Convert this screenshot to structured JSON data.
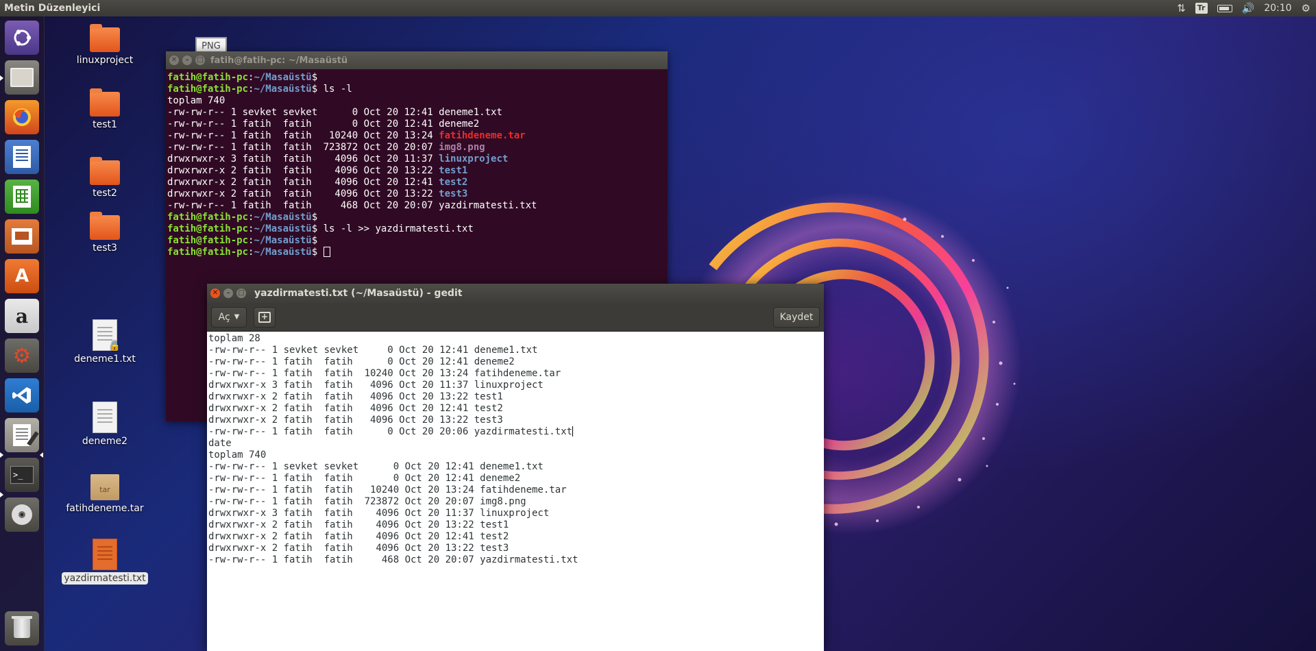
{
  "top_panel": {
    "app_title": "Metin Düzenleyici",
    "keyboard_layout": "Tr",
    "clock": "20:10",
    "icons": [
      "network-icon",
      "battery-icon",
      "volume-icon",
      "settings-gear-icon"
    ]
  },
  "launcher": {
    "items": [
      {
        "name": "ubuntu-dash",
        "icon": "ubuntu-logo-icon"
      },
      {
        "name": "files",
        "icon": "file-manager-icon"
      },
      {
        "name": "firefox",
        "icon": "firefox-icon"
      },
      {
        "name": "libreoffice-writer",
        "icon": "writer-icon"
      },
      {
        "name": "libreoffice-calc",
        "icon": "calc-icon"
      },
      {
        "name": "libreoffice-impress",
        "icon": "impress-icon"
      },
      {
        "name": "software-center",
        "icon": "software-center-icon"
      },
      {
        "name": "amazon",
        "icon": "amazon-icon"
      },
      {
        "name": "system-settings",
        "icon": "settings-tools-icon"
      },
      {
        "name": "vscode",
        "icon": "vscode-icon"
      },
      {
        "name": "text-editor",
        "icon": "text-editor-icon"
      },
      {
        "name": "terminal",
        "icon": "terminal-icon"
      },
      {
        "name": "dvd",
        "icon": "disc-icon"
      },
      {
        "name": "trash",
        "icon": "trash-icon"
      }
    ]
  },
  "desktop": {
    "icons": [
      {
        "label": "linuxproject",
        "type": "folder"
      },
      {
        "label": "test1",
        "type": "folder"
      },
      {
        "label": "test2",
        "type": "folder"
      },
      {
        "label": "test3",
        "type": "folder"
      },
      {
        "label": "deneme1.txt",
        "type": "locked-document"
      },
      {
        "label": "deneme2",
        "type": "document"
      },
      {
        "label": "fatihdeneme.tar",
        "type": "archive"
      },
      {
        "label": "yazdirmatesti.txt",
        "type": "text-document"
      }
    ],
    "png_thumb_label": "PNG"
  },
  "terminal": {
    "title": "fatih@fatih-pc: ~/Masaüstü",
    "prompt_user": "fatih@fatih-pc",
    "prompt_path": "~/Masaüstü",
    "prompt_sign": "$",
    "cmd_ls": " ls -l",
    "cmd_redirect": " ls -l >> yazdirmatesti.txt",
    "total": "toplam 740",
    "rows": [
      {
        "meta": "-rw-rw-r-- 1 sevket sevket      0 Oct 20 12:41 ",
        "name": "deneme1.txt",
        "kind": "file"
      },
      {
        "meta": "-rw-rw-r-- 1 fatih  fatih       0 Oct 20 12:41 ",
        "name": "deneme2",
        "kind": "file"
      },
      {
        "meta": "-rw-rw-r-- 1 fatih  fatih   10240 Oct 20 13:24 ",
        "name": "fatihdeneme.tar",
        "kind": "archive"
      },
      {
        "meta": "-rw-rw-r-- 1 fatih  fatih  723872 Oct 20 20:07 ",
        "name": "img8.png",
        "kind": "image"
      },
      {
        "meta": "drwxrwxr-x 3 fatih  fatih    4096 Oct 20 11:37 ",
        "name": "linuxproject",
        "kind": "dir"
      },
      {
        "meta": "drwxrwxr-x 2 fatih  fatih    4096 Oct 20 13:22 ",
        "name": "test1",
        "kind": "dir"
      },
      {
        "meta": "drwxrwxr-x 2 fatih  fatih    4096 Oct 20 12:41 ",
        "name": "test2",
        "kind": "dir"
      },
      {
        "meta": "drwxrwxr-x 2 fatih  fatih    4096 Oct 20 13:22 ",
        "name": "test3",
        "kind": "dir"
      },
      {
        "meta": "-rw-rw-r-- 1 fatih  fatih     468 Oct 20 20:07 ",
        "name": "yazdirmatesti.txt",
        "kind": "file"
      }
    ]
  },
  "gedit": {
    "title": "yazdirmatesti.txt (~/Masaüstü) - gedit",
    "open_button": "Aç",
    "save_button": "Kaydet",
    "lines": [
      "toplam 28",
      "-rw-rw-r-- 1 sevket sevket     0 Oct 20 12:41 deneme1.txt",
      "-rw-rw-r-- 1 fatih  fatih      0 Oct 20 12:41 deneme2",
      "-rw-rw-r-- 1 fatih  fatih  10240 Oct 20 13:24 fatihdeneme.tar",
      "drwxrwxr-x 3 fatih  fatih   4096 Oct 20 11:37 linuxproject",
      "drwxrwxr-x 2 fatih  fatih   4096 Oct 20 13:22 test1",
      "drwxrwxr-x 2 fatih  fatih   4096 Oct 20 12:41 test2",
      "drwxrwxr-x 2 fatih  fatih   4096 Oct 20 13:22 test3",
      "-rw-rw-r-- 1 fatih  fatih      0 Oct 20 20:06 yazdirmatesti.txt",
      "date",
      "toplam 740",
      "-rw-rw-r-- 1 sevket sevket      0 Oct 20 12:41 deneme1.txt",
      "-rw-rw-r-- 1 fatih  fatih       0 Oct 20 12:41 deneme2",
      "-rw-rw-r-- 1 fatih  fatih   10240 Oct 20 13:24 fatihdeneme.tar",
      "-rw-rw-r-- 1 fatih  fatih  723872 Oct 20 20:07 img8.png",
      "drwxrwxr-x 3 fatih  fatih    4096 Oct 20 11:37 linuxproject",
      "drwxrwxr-x 2 fatih  fatih    4096 Oct 20 13:22 test1",
      "drwxrwxr-x 2 fatih  fatih    4096 Oct 20 12:41 test2",
      "drwxrwxr-x 2 fatih  fatih    4096 Oct 20 13:22 test3",
      "-rw-rw-r-- 1 fatih  fatih     468 Oct 20 20:07 yazdirmatesti.txt"
    ]
  },
  "colors": {
    "terminal_bg": "#300a24",
    "prompt_user": "#8ae234",
    "prompt_path": "#729fcf",
    "dir": "#729fcf",
    "archive": "#ef2929",
    "image": "#ad7fa8",
    "ubuntu_orange": "#e95420"
  }
}
